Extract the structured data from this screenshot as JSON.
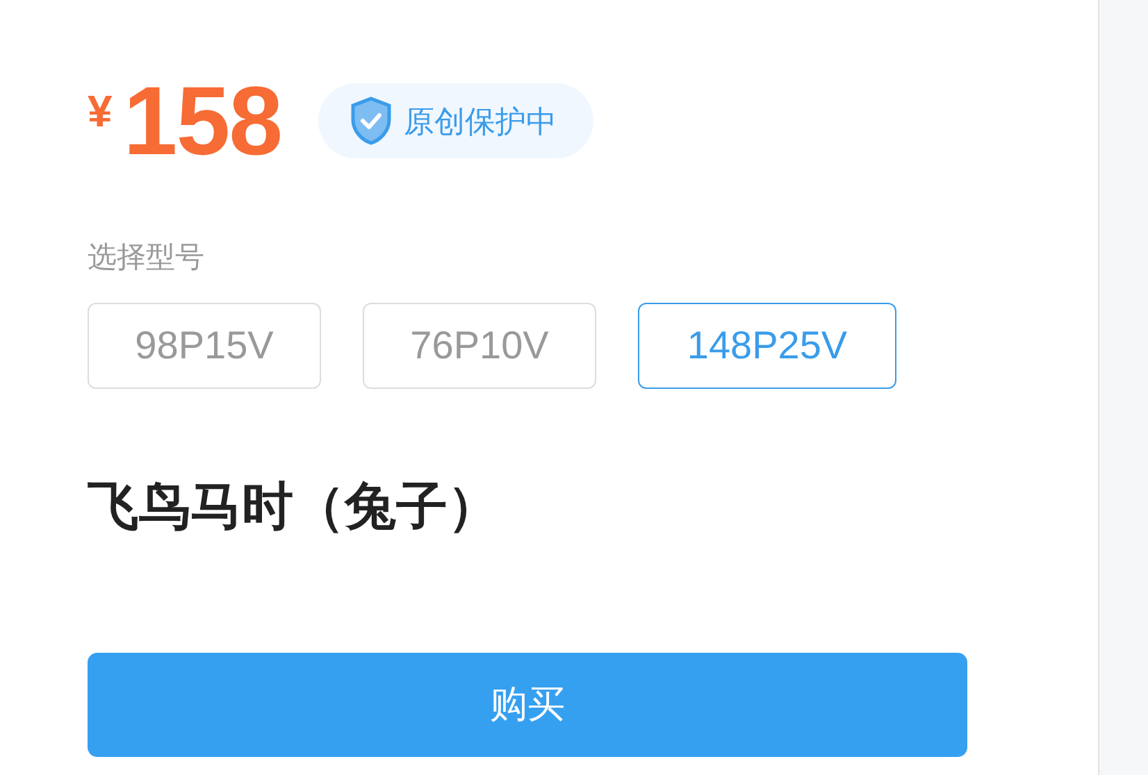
{
  "price": {
    "currency": "¥",
    "amount": "158"
  },
  "badge": {
    "label": "原创保护中"
  },
  "model_label": "选择型号",
  "models": [
    {
      "label": "98P15V",
      "selected": false
    },
    {
      "label": "76P10V",
      "selected": false
    },
    {
      "label": "148P25V",
      "selected": true
    }
  ],
  "product_title": "飞鸟马时（兔子）",
  "buy_button": "购买"
}
